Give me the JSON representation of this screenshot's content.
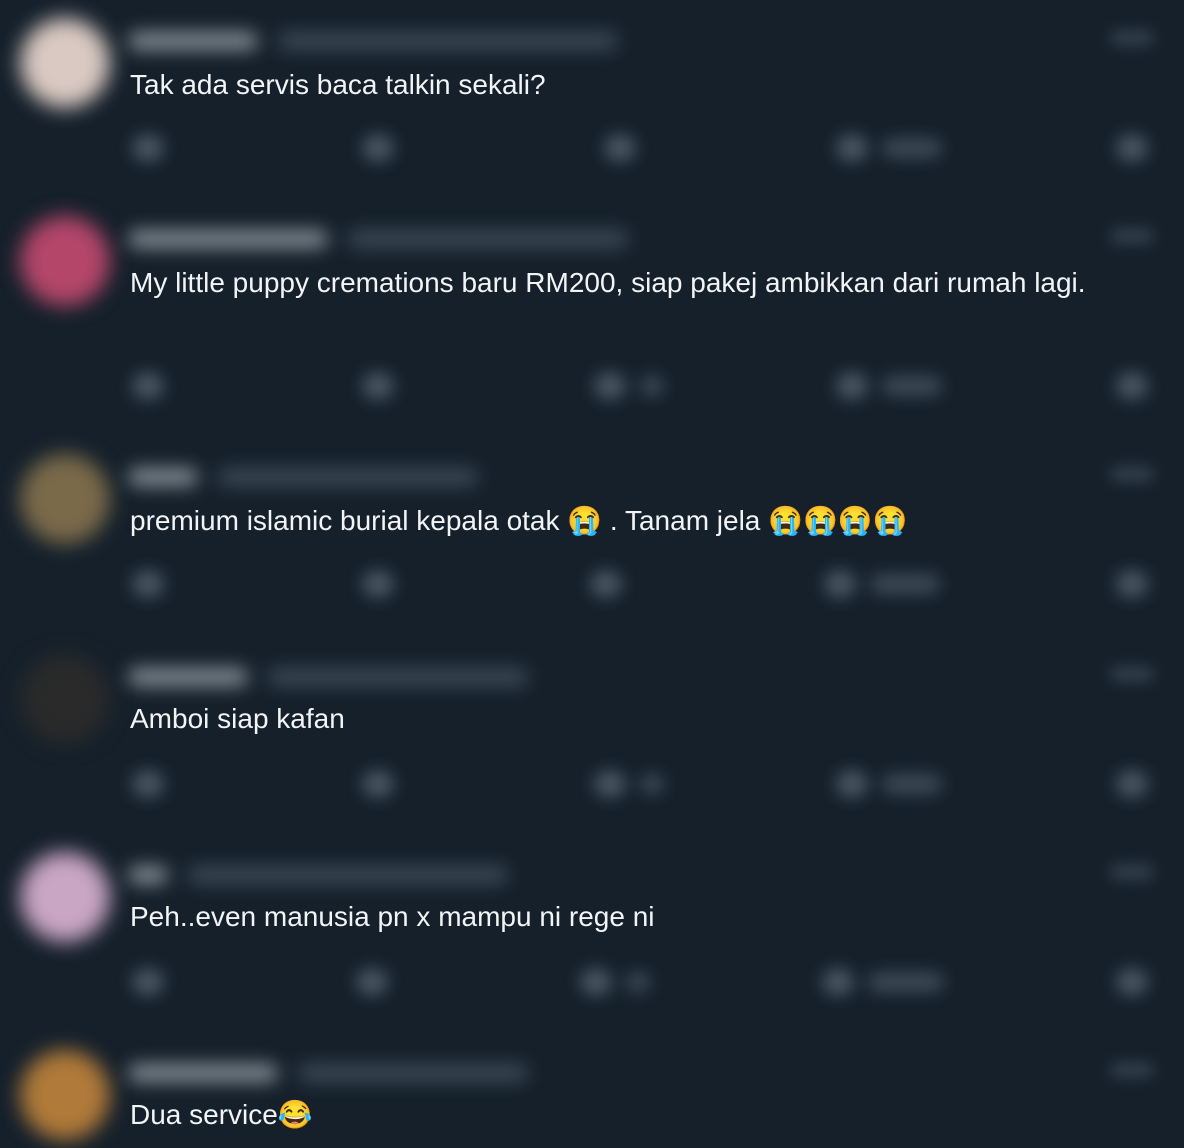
{
  "colors": {
    "background": "#15202b",
    "text": "#f2f4f6",
    "muted": "#8899a6"
  },
  "replies": [
    {
      "text": "Tak ada servis baca talkin sekali?",
      "emoji": "",
      "avatar_color": "#d9c9c2"
    },
    {
      "text": "My little puppy cremations baru RM200, siap pakej ambikkan dari rumah lagi.",
      "emoji": "",
      "avatar_color": "#b4466a"
    },
    {
      "text": "premium islamic burial kepala otak 😭 . Tanam jela 😭😭😭😭",
      "emoji": "",
      "avatar_color": "#7a6a4a"
    },
    {
      "text": "Amboi siap kafan",
      "emoji": "",
      "avatar_color": "#2a2a2a"
    },
    {
      "text": "Peh..even manusia pn x mampu ni rege ni",
      "emoji": "",
      "avatar_color": "#c9a6c4"
    },
    {
      "text": "Dua service😂",
      "emoji": "",
      "avatar_color": "#b07a3a"
    }
  ],
  "icons": {
    "reply": "reply-icon",
    "retweet": "retweet-icon",
    "like": "heart-icon",
    "views": "views-icon",
    "share": "share-icon",
    "more": "more-icon"
  }
}
